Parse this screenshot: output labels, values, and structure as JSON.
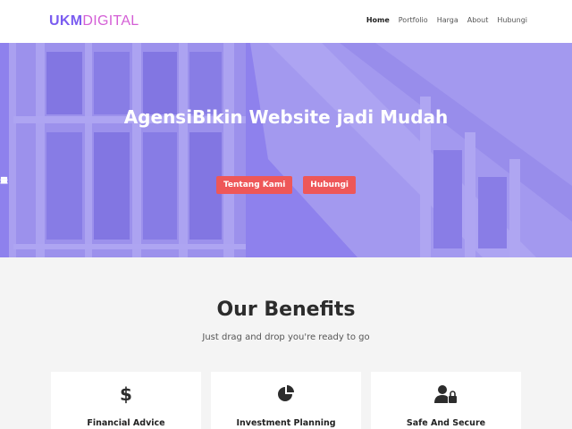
{
  "brand": {
    "part1": "UKM",
    "part2": "DIGITAL"
  },
  "nav": {
    "items": [
      "Home",
      "Portfolio",
      "Harga",
      "About",
      "Hubungi"
    ],
    "active": "Home"
  },
  "hero": {
    "title": "AgensiBikin Website jadi Mudah",
    "buttons": [
      {
        "label": "Tentang Kami",
        "icon": "basket-icon"
      },
      {
        "label": "Hubungi",
        "icon": "cash-register-icon"
      }
    ]
  },
  "benefits": {
    "title": "Our Benefits",
    "subtitle": "Just drag and drop you're ready to go",
    "cards": [
      {
        "label": "Financial Advice",
        "icon": "dollar-icon"
      },
      {
        "label": "Investment Planning",
        "icon": "pie-chart-icon"
      },
      {
        "label": "Safe And Secure",
        "icon": "user-lock-icon"
      }
    ]
  },
  "colors": {
    "brand_purple": "#7a5cf0",
    "brand_pink": "#d45fd6",
    "hero_overlay": "#7869eb",
    "button_red": "#ee5758"
  }
}
